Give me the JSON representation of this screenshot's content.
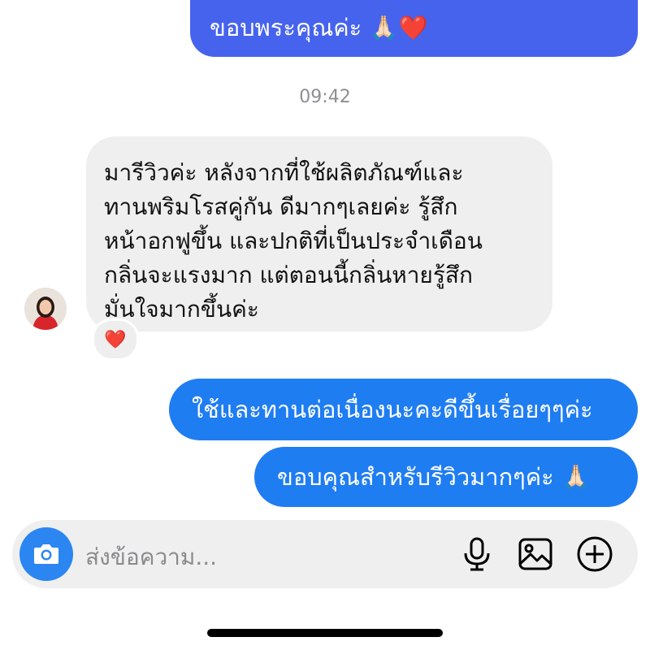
{
  "messages": {
    "outgoing_top": "ขอบพระคุณค่ะ 🙏🏻❤️",
    "timestamp": "09:42",
    "incoming": {
      "lines": [
        "มารีวิวค่ะ หลังจากที่ใช้ผลิตภัณฑ์และ",
        "ทานพริมโรสคู่กัน ดีมากๆเลยค่ะ รู้สึก",
        "หน้าอกฟูขึ้น และปกติที่เป็นประจำเดือน",
        "กลิ่นจะแรงมาก แต่ตอนนี้กลิ่นหายรู้สึก",
        "มั่นใจมากขึ้นค่ะ"
      ],
      "reaction": "❤️"
    },
    "outgoing_1": "ใช้และทานต่อเนื่องนะคะดีขึ้นเรื่อยๆๆค่ะ",
    "outgoing_2": "ขอบคุณสำหรับรีวิวมากๆค่ะ 🙏🏻"
  },
  "composer": {
    "placeholder": "ส่งข้อความ...",
    "icons": [
      "camera-icon",
      "microphone-icon",
      "image-icon",
      "plus-icon"
    ]
  },
  "colors": {
    "outgoing_bubble": "#1f7df2",
    "outgoing_top_bubble": "#4663ee",
    "incoming_bubble": "#efefef",
    "camera_button": "#2b86f2"
  }
}
